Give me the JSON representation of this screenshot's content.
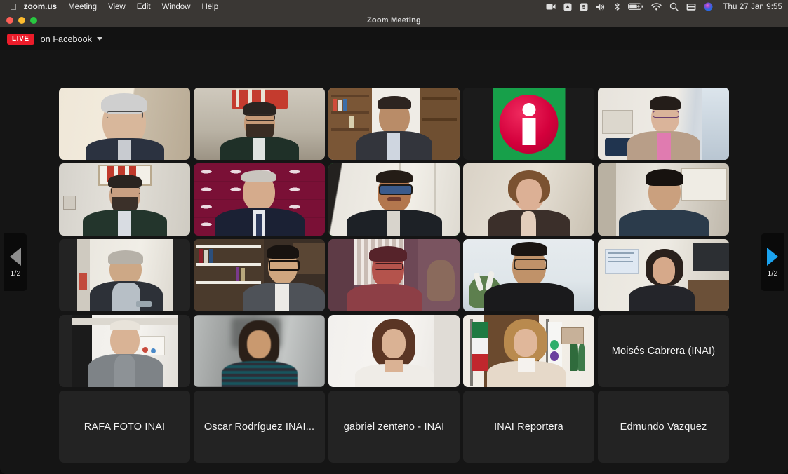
{
  "menubar": {
    "apple_icon": "apple-icon",
    "app_name": "zoom.us",
    "items": [
      "Meeting",
      "View",
      "Edit",
      "Window",
      "Help"
    ],
    "status_icons": [
      "camera-icon",
      "dropbox-icon",
      "shield-icon",
      "volume-icon",
      "bluetooth-icon",
      "battery-charging-icon",
      "wifi-icon",
      "search-icon",
      "display-icon",
      "siri-icon"
    ],
    "clock": "Thu 27 Jan  9:55"
  },
  "window": {
    "title": "Zoom Meeting",
    "traffic_lights": [
      "close-button",
      "minimize-button",
      "zoom-button"
    ]
  },
  "livebar": {
    "badge": "LIVE",
    "destination": "on Facebook",
    "caret_icon": "chevron-down-icon"
  },
  "pagination": {
    "prev_icon": "chevron-left-icon",
    "next_icon": "chevron-right-icon",
    "prev_label": "1/2",
    "next_label": "1/2",
    "prev_enabled": false,
    "next_enabled": true,
    "active_color": "#1aa3f0",
    "inactive_color": "#8d8d8d"
  },
  "gallery": {
    "rows": 5,
    "cols": 5,
    "active_speaker_border_color": "#1fd13b",
    "tiles": [
      {
        "name": "",
        "kind": "video",
        "active": false,
        "fit": "fill"
      },
      {
        "name": "",
        "kind": "video",
        "active": false,
        "fit": "fill"
      },
      {
        "name": "",
        "kind": "video",
        "active": false,
        "fit": "fill"
      },
      {
        "name": "",
        "kind": "logo",
        "active": false,
        "fit": "fill",
        "logo": "inai-logo"
      },
      {
        "name": "",
        "kind": "video",
        "active": false,
        "fit": "fill"
      },
      {
        "name": "",
        "kind": "video",
        "active": false,
        "fit": "fill"
      },
      {
        "name": "",
        "kind": "video",
        "active": false,
        "fit": "fill"
      },
      {
        "name": "",
        "kind": "video",
        "active": true,
        "fit": "fill"
      },
      {
        "name": "",
        "kind": "video",
        "active": false,
        "fit": "fill"
      },
      {
        "name": "",
        "kind": "video",
        "active": false,
        "fit": "fill"
      },
      {
        "name": "",
        "kind": "video",
        "active": false,
        "fit": "pillar"
      },
      {
        "name": "",
        "kind": "video",
        "active": false,
        "fit": "fill"
      },
      {
        "name": "",
        "kind": "video",
        "active": false,
        "fit": "fill"
      },
      {
        "name": "",
        "kind": "video",
        "active": false,
        "fit": "fill"
      },
      {
        "name": "",
        "kind": "video",
        "active": false,
        "fit": "fill"
      },
      {
        "name": "",
        "kind": "video",
        "active": false,
        "fit": "pillar2"
      },
      {
        "name": "",
        "kind": "video",
        "active": false,
        "fit": "fill"
      },
      {
        "name": "",
        "kind": "video",
        "active": false,
        "fit": "fill"
      },
      {
        "name": "",
        "kind": "video",
        "active": false,
        "fit": "fill"
      },
      {
        "name": "Moisés Cabrera (INAI)",
        "kind": "name",
        "active": false,
        "fit": "fill"
      },
      {
        "name": "RAFA FOTO INAI",
        "kind": "name",
        "active": false,
        "fit": "fill"
      },
      {
        "name": "Oscar Rodríguez INAI...",
        "kind": "name",
        "active": false,
        "fit": "fill"
      },
      {
        "name": "gabriel zenteno - INAI",
        "kind": "name",
        "active": false,
        "fit": "fill"
      },
      {
        "name": "INAI Reportera",
        "kind": "name",
        "active": false,
        "fit": "fill"
      },
      {
        "name": "Edmundo Vazquez",
        "kind": "name",
        "active": false,
        "fit": "fill"
      }
    ]
  },
  "colors": {
    "window_bg": "#151515",
    "tile_bg": "#232323",
    "menubar_bg": "#3a3734",
    "live_red": "#ec1c2a",
    "inai_green": "#17a04a",
    "inai_red": "#d4003c"
  }
}
